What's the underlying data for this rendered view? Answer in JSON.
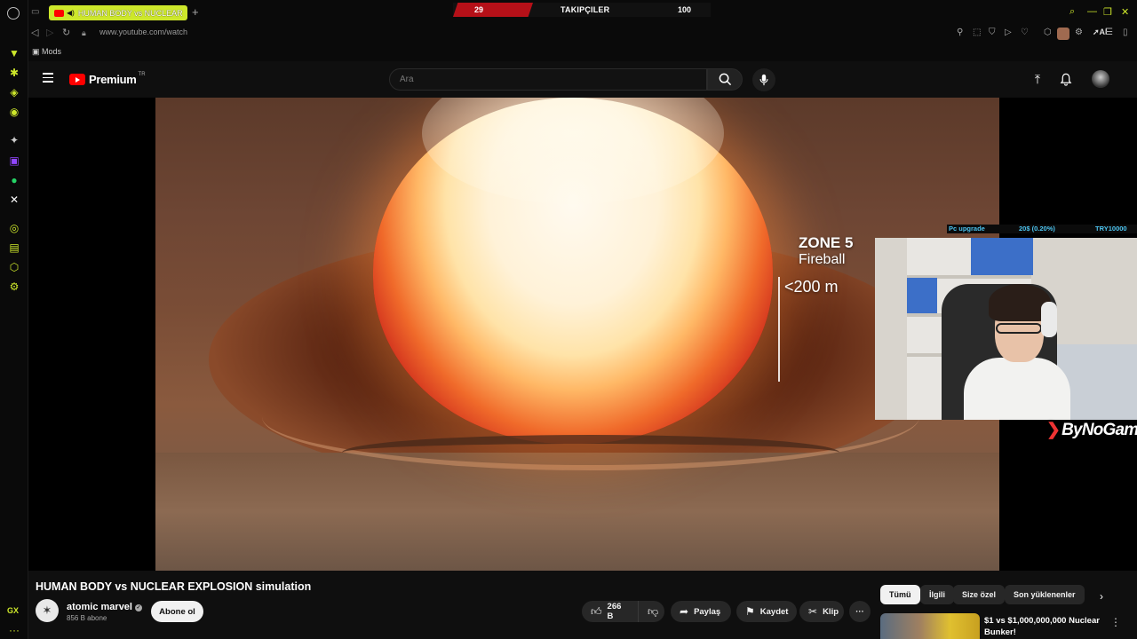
{
  "browser": {
    "tab_title": "HUMAN BODY vs NUCLEAR",
    "new_tab_symbol": "+",
    "url": "www.youtube.com/watch",
    "bookmark": "Mods",
    "ai_label": "AI",
    "gx_label": "GX",
    "accent": "#cde72b"
  },
  "stream_overlay": {
    "left_value": "29",
    "label": "TAKIPÇILER",
    "right_value": "100",
    "goal_name": "Pc upgrade",
    "goal_progress": "20$ (0.20%)",
    "goal_target": "TRY10000",
    "brand": "ByNoGame"
  },
  "youtube": {
    "logo_text": "Premium",
    "country_code": "TR",
    "search_placeholder": "Ara"
  },
  "video": {
    "zone_title": "ZONE 5",
    "zone_name": "Fireball",
    "zone_distance": "<200 m",
    "title": "HUMAN BODY vs NUCLEAR EXPLOSION simulation"
  },
  "channel": {
    "name": "atomic marvel",
    "subscribers": "856 B abone",
    "subscribe_label": "Abone ol"
  },
  "actions": {
    "likes": "266 B",
    "share": "Paylaş",
    "save": "Kaydet",
    "clip": "Klip",
    "more": "···"
  },
  "chips": [
    "Tümü",
    "İlgili",
    "Size özel",
    "Son yüklenenler"
  ],
  "recommendation": {
    "title": "$1 vs $1,000,000,000 Nuclear Bunker!"
  }
}
